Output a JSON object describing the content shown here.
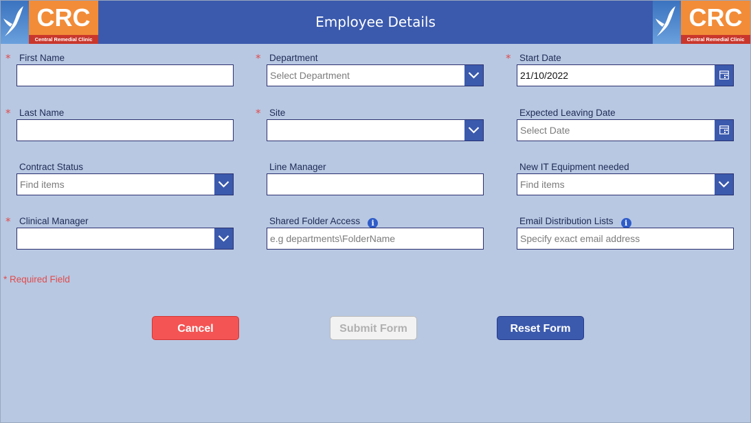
{
  "header": {
    "title": "Employee Details",
    "logo_abbr": "CRC",
    "logo_name": "Central Remedial Clinic"
  },
  "fields": {
    "first_name": {
      "label": "First Name",
      "required": "*",
      "value": ""
    },
    "department": {
      "label": "Department",
      "required": "*",
      "placeholder": "Select Department"
    },
    "start_date": {
      "label": "Start Date",
      "required": "*",
      "value": "21/10/2022"
    },
    "last_name": {
      "label": "Last Name",
      "required": "*",
      "value": ""
    },
    "site": {
      "label": "Site",
      "required": "*",
      "value": ""
    },
    "expected_leaving_date": {
      "label": "Expected Leaving Date",
      "placeholder": "Select Date"
    },
    "contract_status": {
      "label": "Contract Status",
      "placeholder": "Find items"
    },
    "line_manager": {
      "label": "Line Manager",
      "value": ""
    },
    "new_it_equipment": {
      "label": "New IT Equipment needed",
      "placeholder": "Find items"
    },
    "clinical_manager": {
      "label": "Clinical Manager",
      "required": "*",
      "value": ""
    },
    "shared_folder_access": {
      "label": "Shared Folder Access",
      "placeholder": "e.g departments\\FolderName"
    },
    "email_distribution_lists": {
      "label": "Email Distribution Lists",
      "placeholder": "Specify exact email address"
    }
  },
  "required_note": "* Required Field",
  "buttons": {
    "cancel": "Cancel",
    "submit": "Submit Form",
    "reset": "Reset Form"
  },
  "colors": {
    "header": "#3b5aad",
    "background": "#b8c8e2",
    "required": "#e24b4b",
    "cancel": "#f45454",
    "logo_orange": "#f28c38"
  }
}
